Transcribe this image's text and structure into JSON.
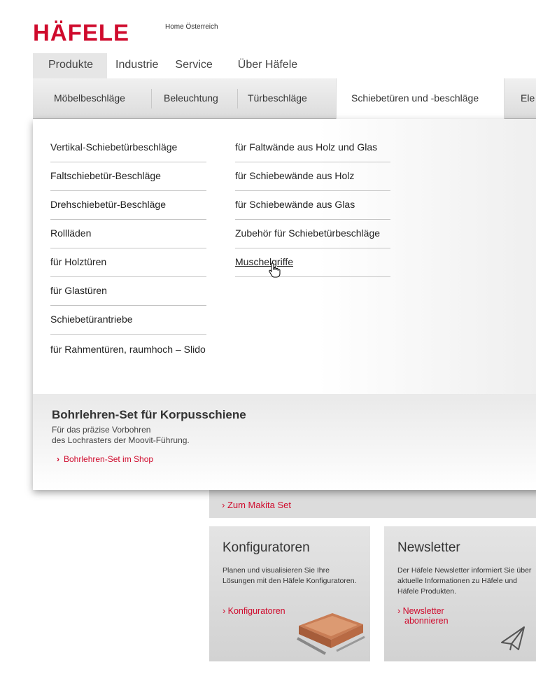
{
  "header": {
    "logo_text": "HÄFELE",
    "home_link": "Home Österreich"
  },
  "main_nav": [
    "Produkte",
    "Industrie",
    "Service",
    "Über Häfele"
  ],
  "sub_nav": [
    "Möbelbeschläge",
    "Beleuchtung",
    "Türbeschläge",
    "Schiebetüren und -beschläge",
    "Ele"
  ],
  "dropdown": {
    "col1": [
      "Vertikal-Schiebetürbeschläge",
      "Faltschiebetür-Beschläge",
      "Drehschiebetür-Beschläge",
      "Rollläden",
      "für Holztüren",
      "für Glastüren",
      "Schiebetürantriebe",
      "für Rahmentüren, raumhoch – Slido"
    ],
    "col2": [
      "für Faltwände aus Holz und Glas",
      "für Schiebewände aus Holz",
      "für Schiebewände aus Glas",
      "Zubehör für Schiebetürbeschläge",
      "Muschelgriffe"
    ],
    "promo": {
      "title": "Bohrlehren-Set für Korpusschiene",
      "desc_line1": "Für das präzise Vorbohren",
      "desc_line2": "des Lochrasters der Moovit-Führung.",
      "link": "Bohrlehren-Set im Shop"
    }
  },
  "tiles": {
    "makita_link": "› Zum Makita Set",
    "konfiguratoren": {
      "title": "Konfiguratoren",
      "text": "Planen und visualisieren Sie Ihre Lösungen mit den Häfele Konfiguratoren.",
      "link": "› Konfiguratoren"
    },
    "newsletter": {
      "title": "Newsletter",
      "text": "Der Häfele Newsletter informiert Sie über aktuelle Informationen zu Häfele und Häfele Produkten.",
      "link_line1": "› Newsletter",
      "link_line2": "abonnieren"
    }
  },
  "colors": {
    "brand": "#cf0a2c"
  },
  "icons": [
    "cursor-hand-icon",
    "paper-plane-icon",
    "drawer-image"
  ]
}
